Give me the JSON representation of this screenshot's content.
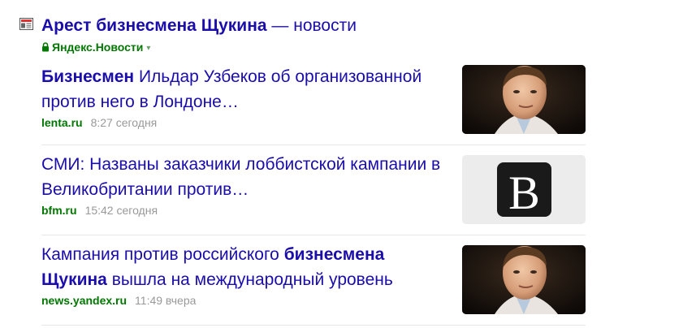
{
  "header": {
    "title_bold": "Арест бизнесмена Щукина",
    "title_rest": " — новости",
    "source": "Яндекс.Новости",
    "caret": "▾"
  },
  "news": [
    {
      "headline_bold": "Бизнесмен",
      "headline_rest": " Ильдар Узбеков об организованной против него в Лондоне…",
      "source": "lenta.ru",
      "time": "8:27 сегодня",
      "thumb": "portrait-photo"
    },
    {
      "headline_bold": "",
      "headline_rest": "СМИ: Названы заказчики лоббистской кампании в Великобритании против…",
      "source": "bfm.ru",
      "time": "15:42 сегодня",
      "thumb": "letter-b-logo"
    },
    {
      "headline_pre": "Кампания против российского ",
      "headline_bold": "бизнесмена Щукина",
      "headline_rest": " вышла на международный уровень",
      "source": "news.yandex.ru",
      "time": "11:49 вчера",
      "thumb": "portrait-photo"
    }
  ]
}
